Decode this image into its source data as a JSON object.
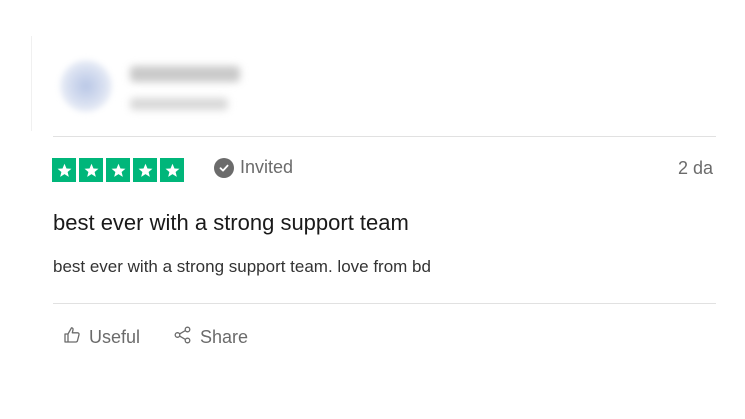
{
  "review": {
    "rating_stars": 5,
    "verification_label": "Invited",
    "date_label": "2 da",
    "title": "best ever with a strong support team",
    "body": "best ever with a strong support team. love from bd"
  },
  "actions": {
    "useful_label": "Useful",
    "share_label": "Share"
  },
  "colors": {
    "star_green": "#00b67a",
    "muted_text": "#6b6b6b"
  },
  "icons": [
    "star-icon",
    "check-circle-icon",
    "thumbs-up-icon",
    "share-icon"
  ]
}
